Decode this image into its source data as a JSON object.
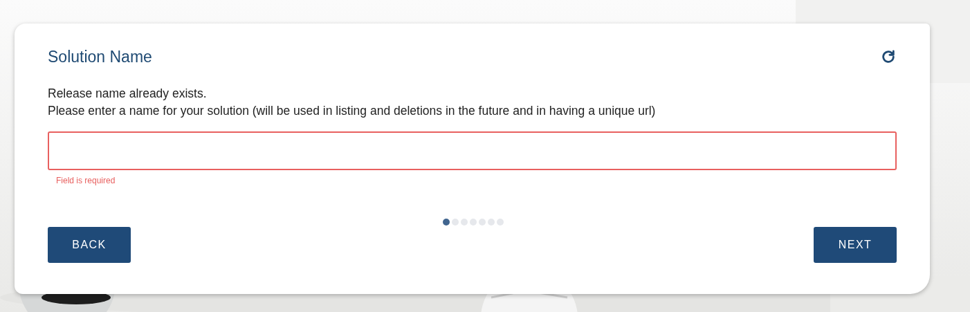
{
  "dialog": {
    "title": "Solution Name",
    "messages": [
      "Release name already exists.",
      "Please enter a name for your solution (will be used in listing and deletions in the future and in having a unique url)"
    ],
    "field": {
      "invalid": true,
      "error": "Field is required"
    },
    "steps": [
      {
        "selected": true
      },
      {
        "selected": false
      },
      {
        "selected": false
      },
      {
        "selected": false
      },
      {
        "selected": false
      },
      {
        "selected": false
      },
      {
        "selected": false
      }
    ],
    "buttons": [
      {
        "label": "BACK"
      },
      {
        "label": "NEXT"
      }
    ]
  }
}
